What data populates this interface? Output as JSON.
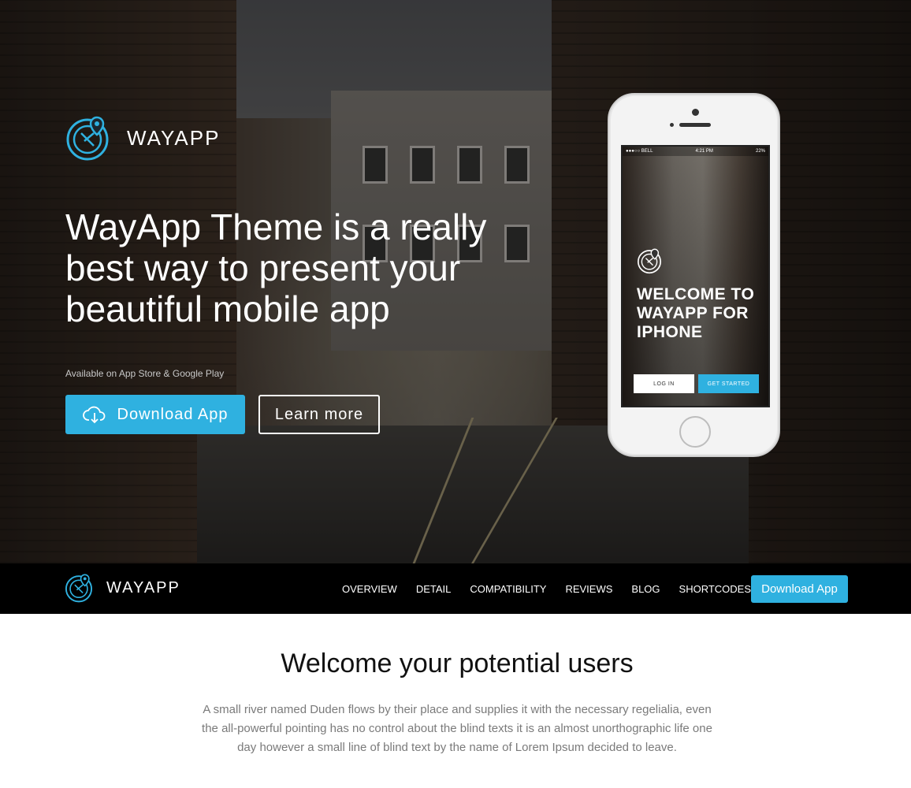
{
  "hero": {
    "brand_name": "WAYAPP",
    "headline": "WayApp Theme is a really best way to present your beautiful mobile app",
    "availability": "Available on App Store & Google Play",
    "download_label": "Download App",
    "learn_label": "Learn more",
    "accent_color": "#2fb1e0"
  },
  "phone": {
    "status_carrier": "●●●○○ BELL",
    "status_time": "4:21 PM",
    "status_battery": "22%",
    "title": "WELCOME TO WAYAPP FOR IPHONE",
    "login_label": "LOG IN",
    "start_label": "GET STARTED"
  },
  "navbar": {
    "brand_name": "WAYAPP",
    "links": [
      "OVERVIEW",
      "DETAIL",
      "COMPATIBILITY",
      "REVIEWS",
      "BLOG",
      "SHORTCODES"
    ],
    "download_label": "Download App"
  },
  "welcome": {
    "title": "Welcome your potential users",
    "body": "A small river named Duden flows by their place and supplies it with the necessary regelialia, even the all-powerful pointing has no control about the blind texts it is an almost unorthographic life one day however a small line of blind text by the name of Lorem Ipsum decided to leave."
  },
  "icons": [
    "compass-logo-icon",
    "cloud-download-icon"
  ]
}
